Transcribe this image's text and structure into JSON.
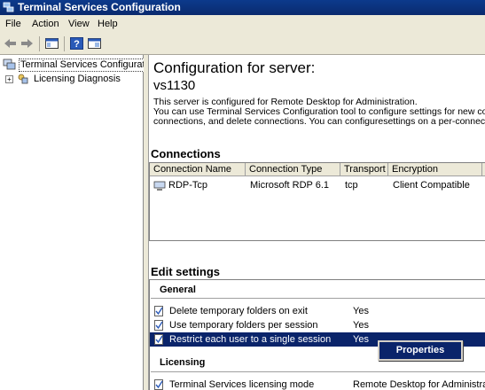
{
  "window": {
    "title": "Terminal Services Configuration",
    "app_icon": "network-computer-icon"
  },
  "menu": {
    "items": [
      "File",
      "Action",
      "View",
      "Help"
    ]
  },
  "toolbar": {
    "buttons": [
      "back-arrow-icon",
      "forward-arrow-icon",
      "show-hide-console-tree-icon",
      "help-icon",
      "show-hide-action-pane-icon"
    ]
  },
  "tree": {
    "items": [
      {
        "label": "Terminal Services Configuration:",
        "icon": "server-computer-icon"
      },
      {
        "label": "Licensing Diagnosis",
        "icon": "licensing-icon",
        "expander": "+"
      }
    ]
  },
  "main": {
    "heading": "Configuration for server:",
    "server_name": "vs1130",
    "description": [
      "This server is configured for Remote Desktop for Administration.",
      "You can use Terminal Services Configuration tool to configure settings for new connections, modify the settings of existing",
      "connections, and delete connections. You can configuresettings on a per-connection basis, or for the server as a whole."
    ],
    "connections_title": "Connections",
    "connections_table": {
      "columns": [
        "Connection Name",
        "Connection Type",
        "Transport",
        "Encryption"
      ],
      "rows": [
        [
          "RDP-Tcp",
          "Microsoft RDP 6.1",
          "tcp",
          "Client Compatible"
        ]
      ]
    },
    "edit_settings_title": "Edit settings",
    "general_heading": "General",
    "general_settings": [
      {
        "label": "Delete temporary folders on exit",
        "value": "Yes"
      },
      {
        "label": "Use temporary folders per session",
        "value": "Yes"
      },
      {
        "label": "Restrict each user to a single session",
        "value": "Yes",
        "selected": true
      }
    ],
    "licensing_heading": "Licensing",
    "licensing_settings": [
      {
        "label": "Terminal Services licensing mode",
        "value": "Remote Desktop for Administration"
      }
    ],
    "context_menu": {
      "label": "Properties"
    }
  },
  "colors": {
    "titlebar": "#0c3a8c",
    "selection": "#0a246a",
    "chrome": "#ece9d8"
  }
}
